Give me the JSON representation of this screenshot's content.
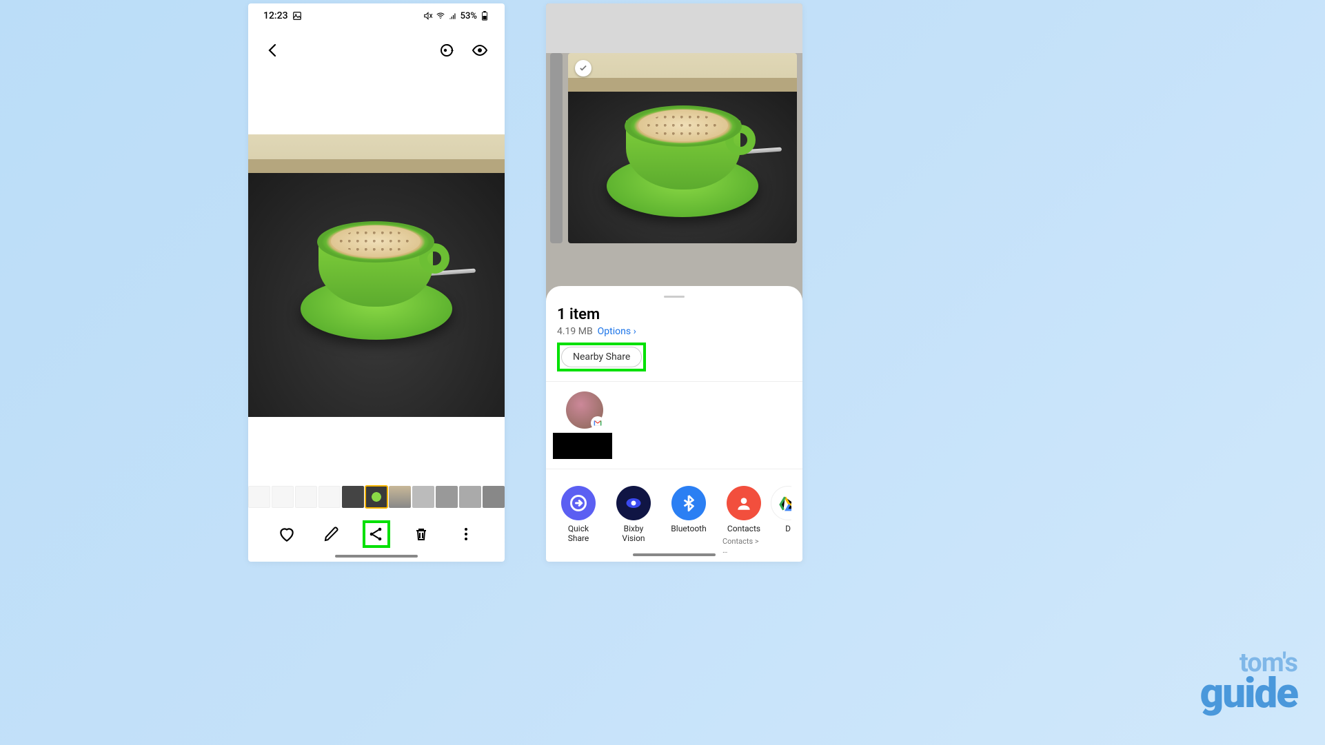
{
  "watermark": {
    "line1": "tom's",
    "line2": "guide"
  },
  "phone1": {
    "status": {
      "time": "12:23",
      "battery": "53%"
    },
    "actions": {
      "favorite": "favorite",
      "edit": "edit",
      "share": "share",
      "delete": "delete",
      "more": "more"
    }
  },
  "phone2": {
    "sheet": {
      "title": "1 item",
      "size": "4.19 MB",
      "options_label": "Options",
      "nearby_label": "Nearby Share"
    },
    "apps": {
      "quick_share": "Quick Share",
      "bixby_vision": "Bixby Vision",
      "bluetooth": "Bluetooth",
      "contacts": "Contacts",
      "contacts_sub": "Contacts > …",
      "drive_initial": "D"
    }
  }
}
